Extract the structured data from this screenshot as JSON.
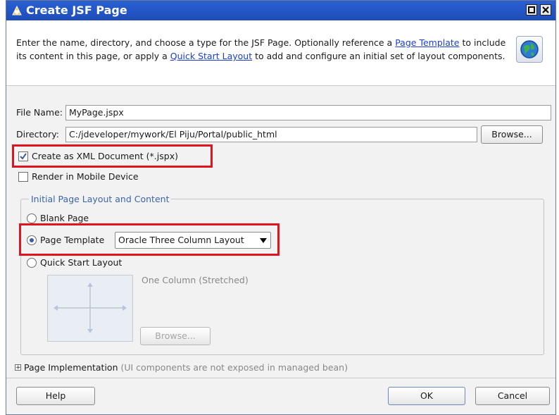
{
  "window": {
    "title": "Create JSF Page",
    "controls": [
      "maximize",
      "close"
    ]
  },
  "header": {
    "description_prefix": "Enter the name, directory, and choose a type for the JSF Page. Optionally reference a ",
    "link_page_template": "Page Template",
    "description_mid": " to include its content in this page, or apply a ",
    "link_quick_start": "Quick Start Layout",
    "description_suffix": " to add  and configure an initial set of layout components.",
    "icon": "globe-help-icon"
  },
  "form": {
    "file_name_label": "File Name:",
    "file_name_value": "MyPage.jspx",
    "directory_label": "Directory:",
    "directory_value": "C:/jdeveloper/mywork/El Piju/Portal/public_html",
    "browse_label": "Browse...",
    "create_xml_label": "Create as XML Document (*.jspx)",
    "create_xml_checked": true,
    "render_mobile_label": "Render in Mobile Device",
    "render_mobile_checked": false
  },
  "layout_group": {
    "legend": "Initial Page Layout and Content",
    "blank_page_label": "Blank Page",
    "page_template_label": "Page Template",
    "page_template_selected": true,
    "template_dropdown_value": "Oracle Three Column Layout",
    "quick_start_label": "Quick Start Layout",
    "quick_start_preview_caption": "One Column (Stretched)",
    "quick_start_browse_label": "Browse..."
  },
  "implementation": {
    "label": "Page Implementation",
    "note": "(UI components are not exposed in managed bean)"
  },
  "footer": {
    "help_label": "Help",
    "ok_label": "OK",
    "cancel_label": "Cancel"
  },
  "colors": {
    "titlebar": "#1e4db8",
    "highlight": "#e0141e",
    "link": "#1c3fcf",
    "legend": "#3c64a8"
  }
}
